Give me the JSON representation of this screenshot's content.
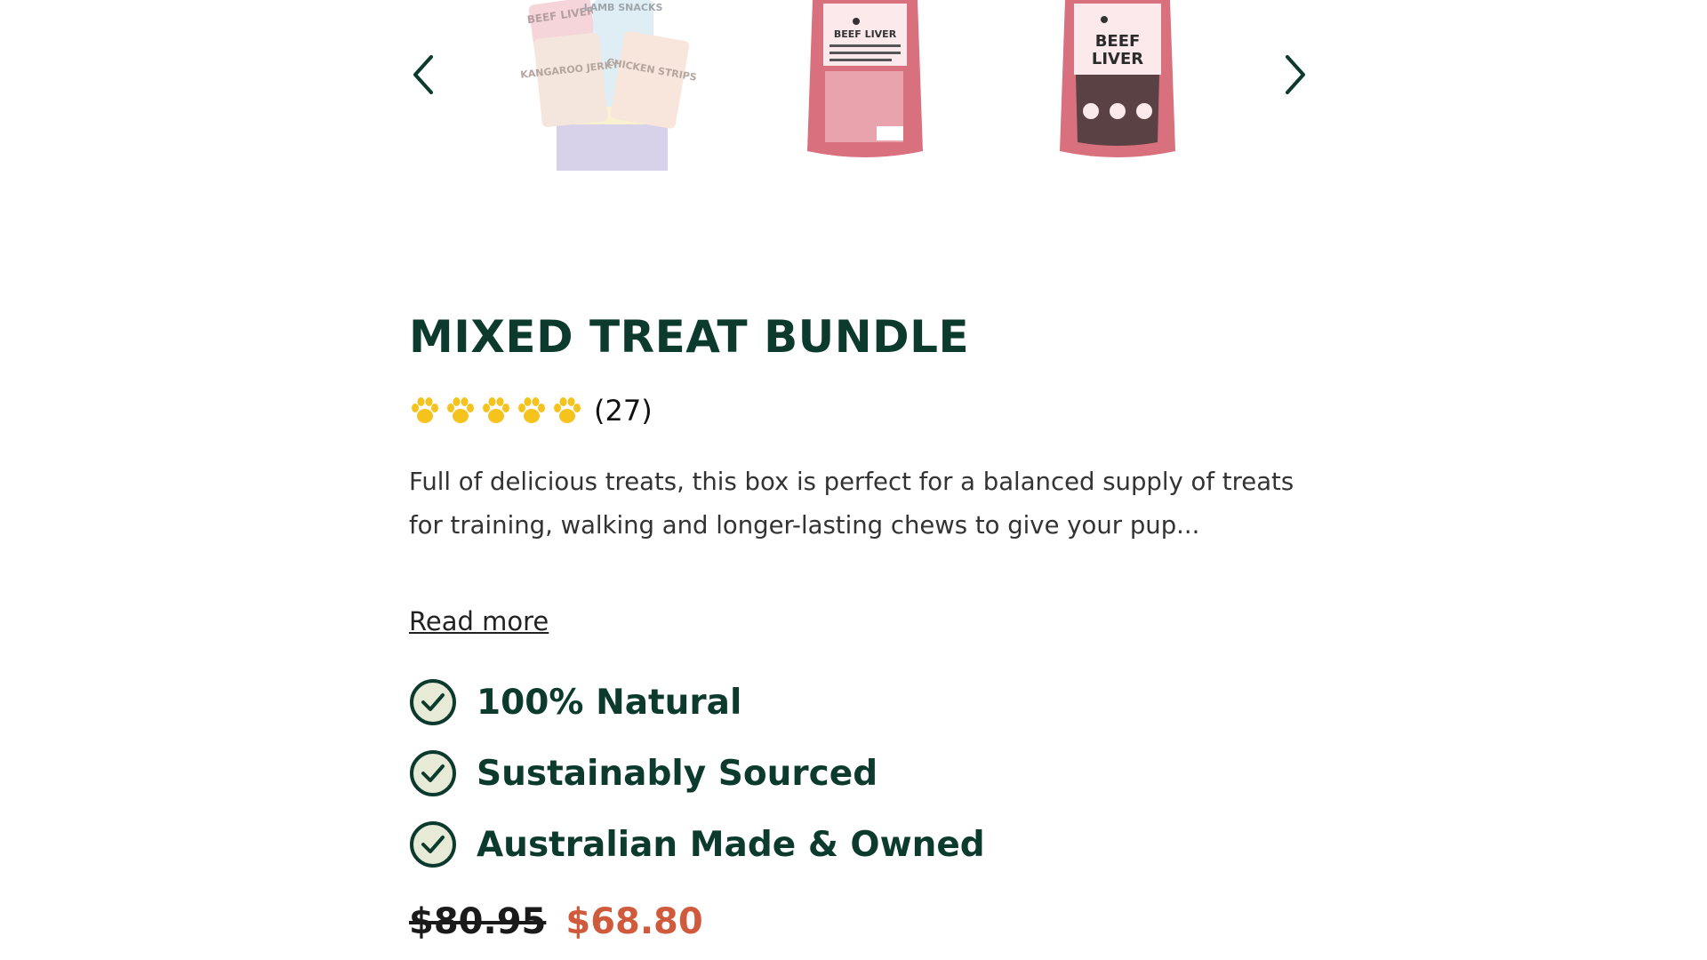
{
  "carousel": {
    "images": [
      {
        "name": "mixed-treat-box-image",
        "labels": [
          "BEEF LIVER",
          "LAMB SNACKS",
          "KANGAROO JERKY",
          "CHICKEN STRIPS"
        ]
      },
      {
        "name": "beef-liver-back-image",
        "labels": [
          "BEEF LIVER"
        ]
      },
      {
        "name": "beef-liver-front-image",
        "labels": [
          "BEEF",
          "LIVER"
        ]
      }
    ]
  },
  "product": {
    "title": "MIXED TREAT BUNDLE",
    "rating": 5,
    "review_count": "(27)",
    "description": "Full of delicious treats, this box is perfect for a balanced supply of treats for training, walking and longer-lasting chews to give your pup...",
    "read_more": "Read more",
    "features": [
      {
        "label": "100% Natural"
      },
      {
        "label": "Sustainably Sourced"
      },
      {
        "label": "Australian Made & Owned"
      }
    ],
    "old_price": "$80.95",
    "new_price": "$68.80"
  },
  "colors": {
    "brand_green": "#0c3b2e",
    "paw_yellow": "#f6c21c",
    "sale_red": "#d05a3c",
    "check_fill": "#e7ead6",
    "bag_pink": "#d9707e"
  }
}
